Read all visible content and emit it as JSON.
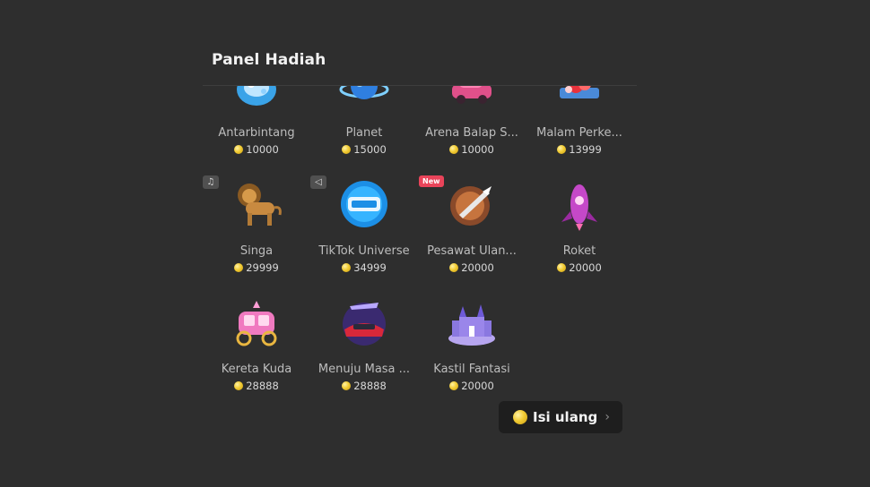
{
  "panel": {
    "title": "Panel Hadiah"
  },
  "gifts": [
    {
      "name": "Antarbintang",
      "price": "10000",
      "icon": "galaxy-gift-icon"
    },
    {
      "name": "Planet",
      "price": "15000",
      "icon": "planet-gift-icon"
    },
    {
      "name": "Arena Balap S...",
      "price": "10000",
      "icon": "race-car-gift-icon"
    },
    {
      "name": "Malam Perke...",
      "price": "13999",
      "icon": "party-gift-icon"
    },
    {
      "name": "Singa",
      "price": "29999",
      "icon": "lion-gift-icon",
      "tag": "music-note-icon"
    },
    {
      "name": "TikTok Universe",
      "price": "34999",
      "icon": "tiktok-universe-gift-icon",
      "tag": "megaphone-icon"
    },
    {
      "name": "Pesawat Ulan...",
      "price": "20000",
      "icon": "space-shuttle-gift-icon",
      "badge": "New"
    },
    {
      "name": "Roket",
      "price": "20000",
      "icon": "rocket-gift-icon"
    },
    {
      "name": "Kereta Kuda",
      "price": "28888",
      "icon": "carriage-gift-icon"
    },
    {
      "name": "Menuju Masa ...",
      "price": "28888",
      "icon": "future-car-gift-icon"
    },
    {
      "name": "Kastil Fantasi",
      "price": "20000",
      "icon": "castle-gift-icon"
    }
  ],
  "topup": {
    "label": "Isi ulang",
    "icon": "coin-icon",
    "chevron": "chevron-right-icon"
  },
  "colors": {
    "background": "#2e2e2e",
    "coin": "#f2cc34",
    "new_badge": "#e9445a"
  }
}
